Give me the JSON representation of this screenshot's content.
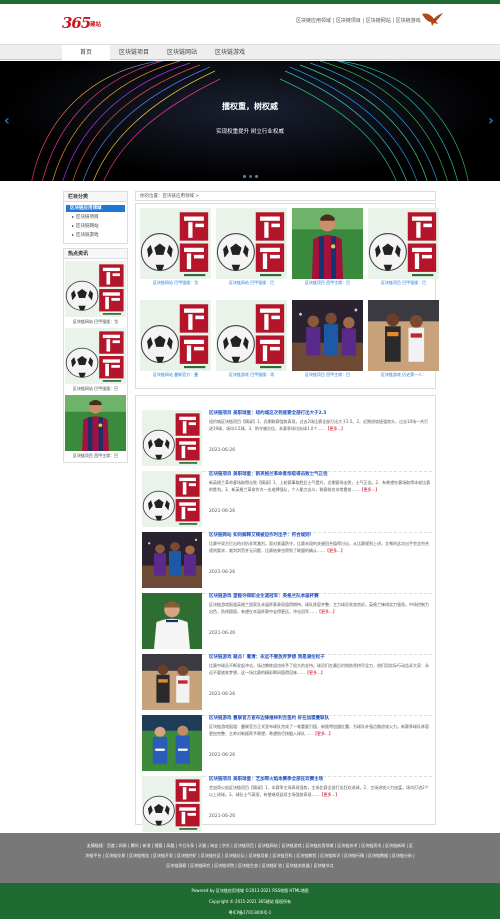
{
  "brand": {
    "logo_num": "365",
    "logo_sub": "建站"
  },
  "header": {
    "toplinks": "区块链应用领域 | 区块链项目 | 区块链网站 | 区块链游戏"
  },
  "nav": {
    "items": [
      "首页",
      "区块链项目",
      "区块链网站",
      "区块链游戏"
    ],
    "active_index": 0
  },
  "banner": {
    "title": "擂权重，树权威",
    "subtitle": "实现权重提升 树立行业权威",
    "slides": 3,
    "active_slide": 1
  },
  "sidebar": {
    "category_title": "栏目分类",
    "category_main": "区块链应用领域",
    "category_subs": [
      "区块链项目",
      "区块链网站",
      "区块链游戏"
    ],
    "hot_title": "热点资讯",
    "hot_items": [
      {
        "caption": "区块链网站 巴甲强援：戈",
        "image": "football-ad"
      },
      {
        "caption": "区块链网站 巴甲强援：巴",
        "image": "football-ad"
      },
      {
        "caption": "区块链项目 西甲主席：巴",
        "image": "messi"
      }
    ]
  },
  "breadcrumb": "你的位置：区块链应用领域 >",
  "grid": [
    {
      "caption": "区块链网站 巴甲强援：戈",
      "image": "football-ad"
    },
    {
      "caption": "区块链网站 巴甲强援：巴",
      "image": "football-ad"
    },
    {
      "caption": "区块链项目 西甲主席：巴",
      "image": "messi"
    },
    {
      "caption": "区块链项目 巴甲强援：巴",
      "image": "football-ad"
    },
    {
      "caption": "区块链网站 曼联官方：曼",
      "image": "football-ad"
    },
    {
      "caption": "区块链游戏 巴甲强援：再",
      "image": "football-ad"
    },
    {
      "caption": "区块链项目 西甲主席：巴",
      "image": "basketball"
    },
    {
      "caption": "区块链游戏 历史第一人：",
      "image": "basketball2"
    }
  ],
  "articles": [
    {
      "title": "区块链项目 美职球星：纽约城这次到底要全部打出大于2.5",
      "desc": "纽约城区块链项目【摘录】1、近期联赛强势表现，过去2场比赛全部打出大于2.5。2、近期进攻极强势头，过去10场一共打进19球，场均3.5球。3、防守端欠佳，本赛季场均失球1.0个……",
      "more": "【更多...】",
      "date": "2021-06-26",
      "image": "football-ad"
    },
    {
      "title": "区块链项目 美职球星：新英格兰革命客场取得击败士气正佳",
      "desc": "新英格兰革命客场取得击败【摘录】1、上轮赛事取胜后士气提升，近期客场击败，士气正佳。2、有希望在客场取得本轮比赛的胜利。3、新英格兰革命作为一支老牌强队，个人能力出众，联赛排名非常靠前……",
      "more": "【更多...】",
      "date": "2021-06-26",
      "image": "football-ad"
    },
    {
      "title": "区块链网站 如何解释艾顿被迫作时出手：符合规则！",
      "desc": "比赛中双方打出的对抗非常激烈，面对紧逼防守，比赛末段的关键回合值得讨论。从比赛规则上讲，艾顿的这次出手完全符合规则要求，裁判判罚并无问题，比赛结果也得到了联盟的确认……",
      "more": "【更多...】",
      "date": "2021-06-26",
      "image": "basketball"
    },
    {
      "title": "区块链游戏 望能夺得职业生涯冠军：英格兰队本届杯赛",
      "desc": "区块链游戏报道英格兰国家队本届杯赛表现值得期待，球队阵容齐整，主力球员状态良好。英格兰锋线实力强劲，中场控制力出色，防线稳固，有望在本届杯赛中走得更远，冲击冠军……",
      "more": "【更多...】",
      "date": "2021-06-26",
      "image": "kane"
    },
    {
      "title": "区块链游戏 疑点！看清：永远不要放弃梦想 我是湖伦松子",
      "desc": "比赛中球员不断发起冲击，场边教练组也给予了很大的支持。球员们在最后时刻依然拼尽全力，他们用实际行动告诉大家：永远不要放弃梦想，这一场比赛的精彩瞬间值得回味……",
      "more": "【更多...】",
      "date": "2021-06-26",
      "image": "basketball2"
    },
    {
      "title": "区块链游戏 曼联官方宣布边锋维林利吉签约 好在加盟曼联队",
      "desc": "区块链游戏报道：曼联官方正式宣布球队完成了一笔重要引援，新援将加盟红魔，为球队补强边路进攻火力。新赛季球队阵容更加完整，主帅对新援寄予厚望，希望他尽快融入球队……",
      "more": "【更多...】",
      "date": "2021-06-26",
      "image": "players-blue"
    },
    {
      "title": "区块链项目 美职球星：芝加哥火焰本赛季全部狂欢赛主场",
      "desc": "芝加哥火焰区块链项目【摘录】1、本赛季主场表现强势，主场比赛全部打出狂欢进球。2、主场进攻火力凶猛，场均打进2个以上进球。3、球队士气高涨，有望继续延续主场强势表现……",
      "more": "【更多...】",
      "date": "2021-06-26",
      "image": "football-ad"
    }
  ],
  "footer": {
    "links": "友情链接：百度 | 网易 | 腾讯 | 新浪 | 搜狐 | 凤凰 | 今日头条 | 天猫 | 淘宝 | 京东 | 区块链项目 | 区块链网站 | 区块链游戏 | 区块链应用领域 | 区块链技术 | 区块链资讯 | 区块链新闻 | 区块链平台 | 区块链交易 | 区块链钱包 | 区块链开发 | 区块链挖矿 | 区块链社区 | 区块链论坛 | 区块链导航 | 区块链百科 | 区块链教程 | 区块链知识 | 区块链行情 | 区块链数据 | 区块链分析 | 区块链观察 | 区块链研究 | 区块链学院 | 区块链生态 | 区块链矿池 | 区块链浏览器 | 区块链节点",
    "powered": "Powered by 区块链应用领域 ©2013-2021 RSS地图 HTML地图",
    "copyright": "Copyright © 2015-2021 365建站 版权所有",
    "icp": "粤ICP备17013400号-1"
  },
  "colors": {
    "brand_green": "#1f6b32",
    "accent_blue": "#1f78d6",
    "footer_gray": "#787878",
    "logo_red": "#c8171d",
    "more_red": "#d0021b"
  }
}
